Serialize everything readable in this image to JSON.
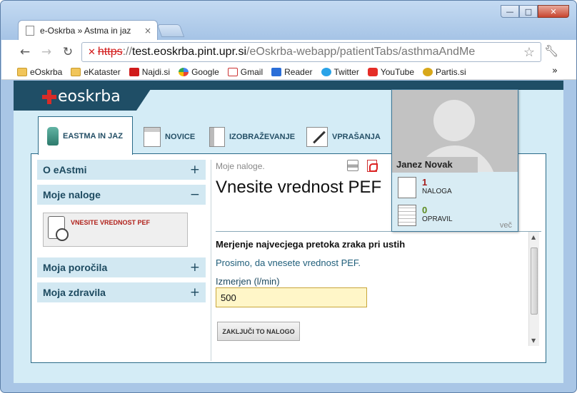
{
  "browser": {
    "tab_title": "e-Oskrba » Astma in jaz",
    "tab_close": "×",
    "url_scheme": "https",
    "url_sep": "://",
    "url_host": "test.eoskrba.pint.upr.si",
    "url_path": "/eOskrba-webapp/patientTabs/asthmaAndMe",
    "bookmarks": [
      "eOskrba",
      "eKataster",
      "Najdi.si",
      "Google",
      "Gmail",
      "Reader",
      "Twitter",
      "YouTube",
      "Partis.si"
    ],
    "bookmarks_more": "»",
    "controls": {
      "min": "—",
      "max": "□",
      "close": "✕"
    }
  },
  "site": {
    "logo": "eoskrba",
    "tabs": [
      {
        "label": "EASTMA IN JAZ",
        "icon": "inhaler-icon",
        "active": true
      },
      {
        "label": "NOVICE",
        "icon": "newspaper-icon"
      },
      {
        "label": "IZOBRAŽEVANJE",
        "icon": "book-icon"
      },
      {
        "label": "VPRAŠANJA",
        "icon": "pen-icon"
      }
    ]
  },
  "sidebar": {
    "sections": [
      {
        "label": "O eAstmi",
        "sign": "+"
      },
      {
        "label": "Moje naloge",
        "sign": "−"
      },
      {
        "label": "Moja poročila",
        "sign": "+"
      },
      {
        "label": "Moja zdravila",
        "sign": "+"
      }
    ],
    "task": "VNESITE VREDNOST PEF"
  },
  "main": {
    "breadcrumb": "Moje naloge.",
    "title": "Vnesite vrednost PEF",
    "form_heading": "Merjenje najvecjega pretoka zraka pri ustih",
    "hint": "Prosimo, da vnesete vrednost PEF.",
    "field_label": "Izmerjen (l/min)",
    "field_value": "500",
    "finish_label": "ZAKLJUČI TO NALOGO"
  },
  "profile": {
    "name": "Janez Novak",
    "tasks_count": "1",
    "tasks_label": "NALOGA",
    "done_count": "0",
    "done_label": "OPRAVIL",
    "more": "več"
  }
}
